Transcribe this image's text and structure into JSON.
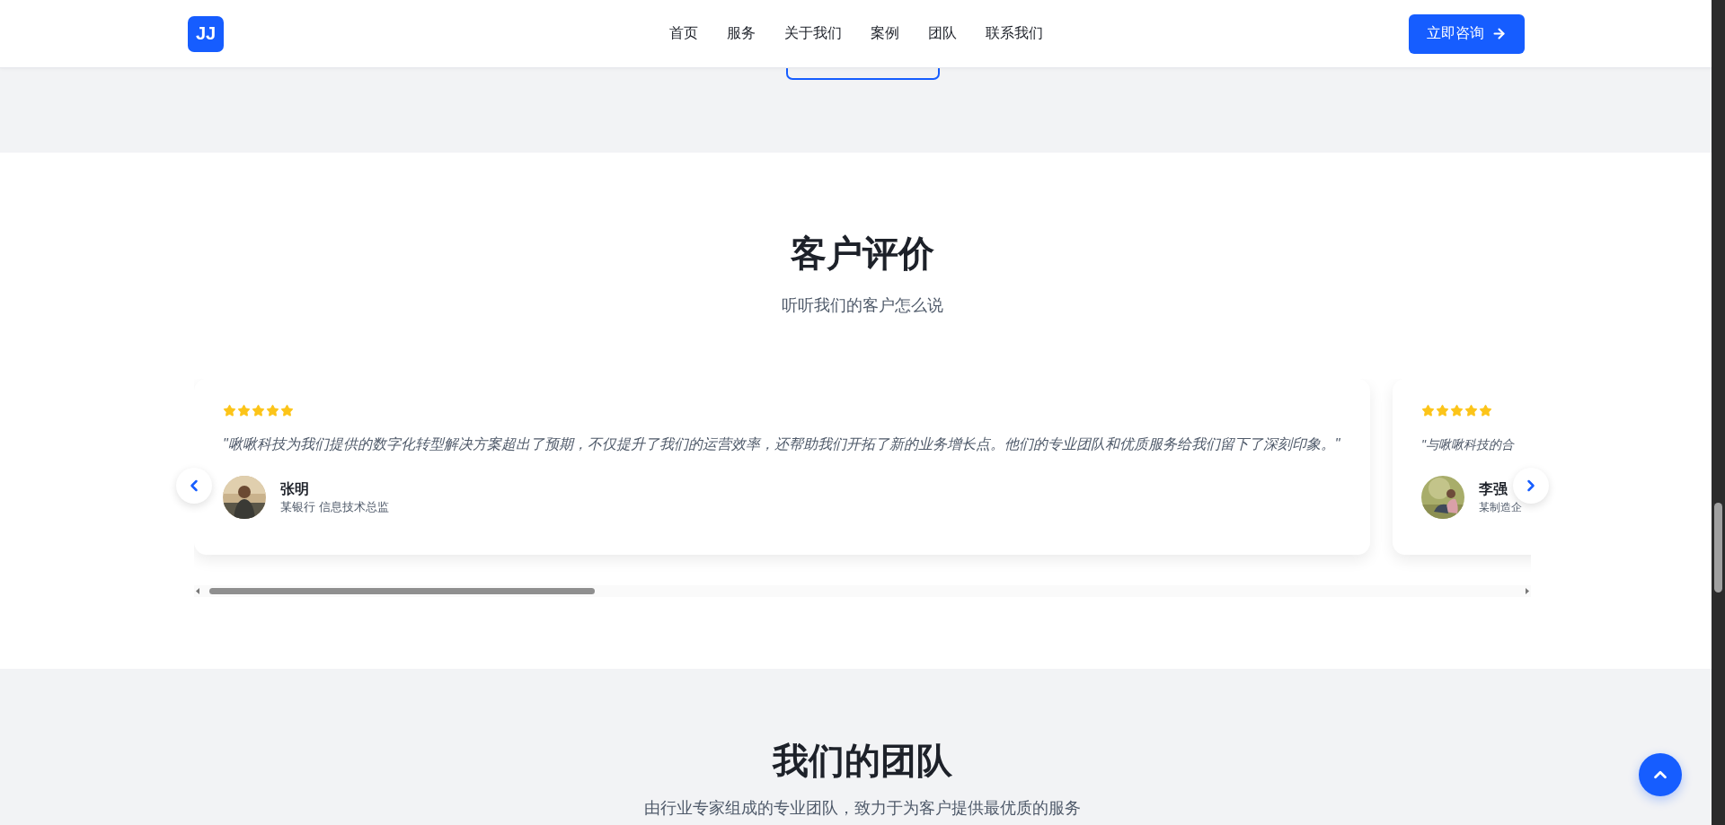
{
  "header": {
    "logo": "JJ",
    "nav": [
      {
        "label": "首页"
      },
      {
        "label": "服务"
      },
      {
        "label": "关于我们"
      },
      {
        "label": "案例"
      },
      {
        "label": "团队"
      },
      {
        "label": "联系我们"
      }
    ],
    "cta": "立即咨询"
  },
  "testimonials_section": {
    "title": "客户评价",
    "subtitle": "听听我们的客户怎么说",
    "testimonials": [
      {
        "stars": 5,
        "quote": "\"啾啾科技为我们提供的数字化转型解决方案超出了预期，不仅提升了我们的运营效率，还帮助我们开拓了新的业务增长点。他们的专业团队和优质服务给我们留下了深刻印象。\"",
        "name": "张明",
        "role": "某银行 信息技术总监"
      },
      {
        "stars": 5,
        "quote": "\"与啾啾科技的合",
        "name": "李强",
        "role": "某制造企"
      }
    ]
  },
  "team_section": {
    "title": "我们的团队",
    "subtitle": "由行业专家组成的专业团队，致力于为客户提供最优质的服务"
  }
}
